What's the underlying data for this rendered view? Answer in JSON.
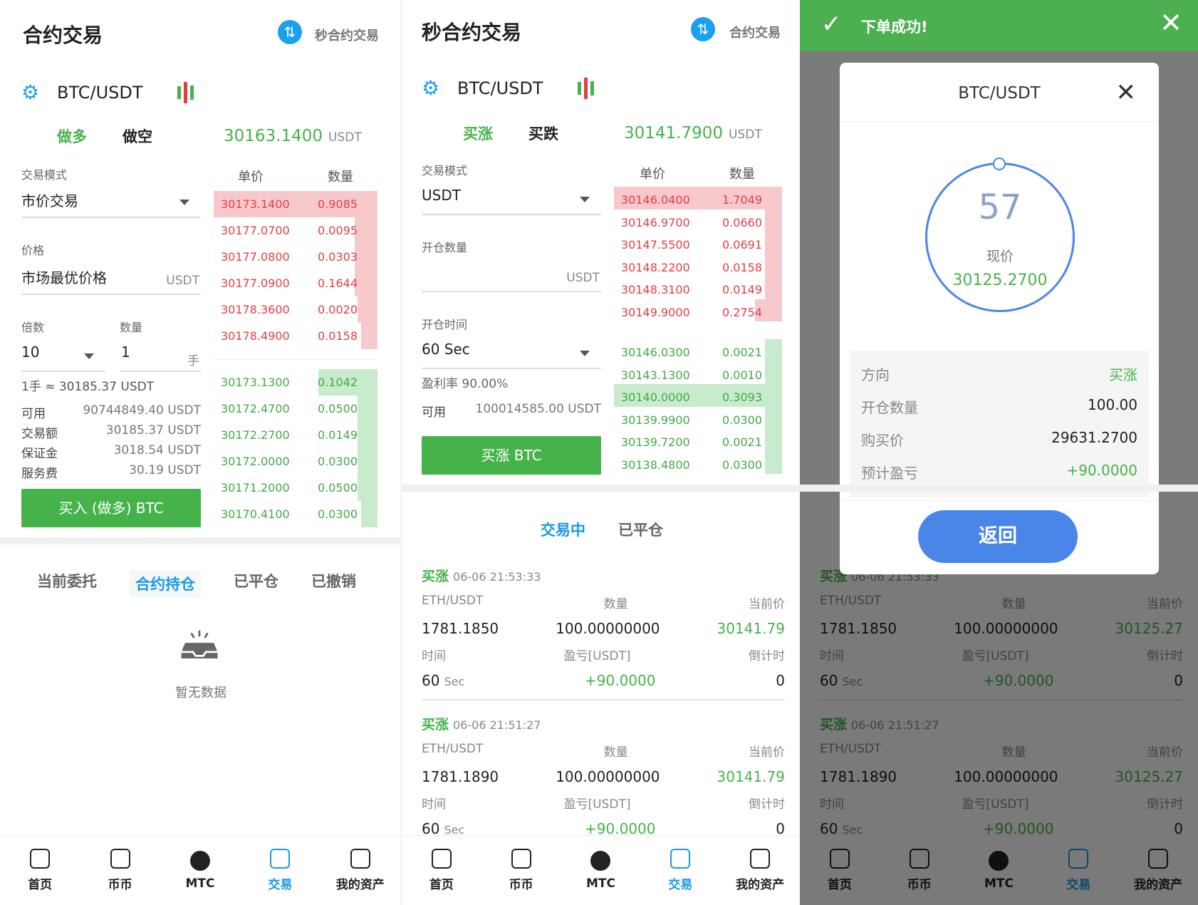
{
  "nav": {
    "home": "首页",
    "coin": "币币",
    "mtc": "MTC",
    "trade": "交易",
    "assets": "我的资产"
  },
  "p1": {
    "title": "合约交易",
    "link": "秒合约交易",
    "pair": "BTC/USDT",
    "tab_long": "做多",
    "tab_short": "做空",
    "price": "30163.1400",
    "unit": "USDT",
    "mode_label": "交易模式",
    "mode_value": "市价交易",
    "price_label": "价格",
    "price_value": "市场最优价格",
    "price_unit": "USDT",
    "mult_label": "倍数",
    "qty_label": "数量",
    "mult_value": "10",
    "qty_value": "1",
    "qty_unit": "手",
    "lot_note": "1手 ≈ 30185.37 USDT",
    "rows": [
      {
        "k": "可用",
        "v": "90744849.40 USDT"
      },
      {
        "k": "交易额",
        "v": "30185.37 USDT"
      },
      {
        "k": "保证金",
        "v": "3018.54 USDT"
      },
      {
        "k": "服务费",
        "v": "30.19 USDT"
      }
    ],
    "buy_btn": "买入 (做多) BTC",
    "ob_price": "单价",
    "ob_qty": "数量",
    "sells": [
      {
        "p": "30173.1400",
        "q": "0.9085",
        "w": 1.0
      },
      {
        "p": "30177.0700",
        "q": "0.0095",
        "w": 0.14
      },
      {
        "p": "30177.0800",
        "q": "0.0303",
        "w": 0.14
      },
      {
        "p": "30177.0900",
        "q": "0.1644",
        "w": 0.14
      },
      {
        "p": "30178.3600",
        "q": "0.0020",
        "w": 0.12
      },
      {
        "p": "30178.4900",
        "q": "0.0158",
        "w": 0.1
      }
    ],
    "buys": [
      {
        "p": "30173.1300",
        "q": "0.1042",
        "w": 0.36
      },
      {
        "p": "30172.4700",
        "q": "0.0500",
        "w": 0.12
      },
      {
        "p": "30172.2700",
        "q": "0.0149",
        "w": 0.12
      },
      {
        "p": "30172.0000",
        "q": "0.0300",
        "w": 0.12
      },
      {
        "p": "30171.2000",
        "q": "0.0500",
        "w": 0.12
      },
      {
        "p": "30170.4100",
        "q": "0.0300",
        "w": 0.1
      }
    ],
    "tabs": [
      "当前委托",
      "合约持仓",
      "已平仓",
      "已撤销"
    ],
    "empty": "暂无数据"
  },
  "p2": {
    "title": "秒合约交易",
    "link": "合约交易",
    "pair": "BTC/USDT",
    "tab_up": "买涨",
    "tab_down": "买跌",
    "price": "30141.7900",
    "unit": "USDT",
    "mode_label": "交易模式",
    "mode_value": "USDT",
    "open_qty_label": "开仓数量",
    "open_qty_unit": "USDT",
    "open_time_label": "开仓时间",
    "open_time_value": "60 Sec",
    "rate": "盈利率 90.00%",
    "avail_k": "可用",
    "avail_v": "100014585.00  USDT",
    "buy_btn": "买涨 BTC",
    "ob_price": "单价",
    "ob_qty": "数量",
    "sells": [
      {
        "p": "30146.0400",
        "q": "1.7049",
        "w": 1.0
      },
      {
        "p": "30146.9700",
        "q": "0.0660",
        "w": 0.1
      },
      {
        "p": "30147.5500",
        "q": "0.0691",
        "w": 0.1
      },
      {
        "p": "30148.2200",
        "q": "0.0158",
        "w": 0.1
      },
      {
        "p": "30148.3100",
        "q": "0.0149",
        "w": 0.1
      },
      {
        "p": "30149.9000",
        "q": "0.2754",
        "w": 0.16
      }
    ],
    "buys": [
      {
        "p": "30146.0300",
        "q": "0.0021",
        "w": 0.1
      },
      {
        "p": "30143.1300",
        "q": "0.0010",
        "w": 0.1
      },
      {
        "p": "30140.0000",
        "q": "0.3093",
        "w": 1.0
      },
      {
        "p": "30139.9900",
        "q": "0.0300",
        "w": 0.1
      },
      {
        "p": "30139.7200",
        "q": "0.0021",
        "w": 0.1
      },
      {
        "p": "30138.4800",
        "q": "0.0300",
        "w": 0.1
      }
    ],
    "tabs": [
      "交易中",
      "已平仓"
    ],
    "orders": [
      {
        "dir": "买涨",
        "time": "06-06 21:53:33",
        "pair": "ETH/USDT",
        "qty_h": "数量",
        "cur_h": "当前价",
        "open": "1781.1850",
        "qty": "100.00000000",
        "cur": "30141.79",
        "t_h": "时间",
        "pl_h": "盈亏[USDT]",
        "cd_h": "倒计时",
        "t": "60",
        "t_unit": "Sec",
        "pl": "+90.0000",
        "cd": "0"
      },
      {
        "dir": "买涨",
        "time": "06-06 21:51:27",
        "pair": "ETH/USDT",
        "qty_h": "数量",
        "cur_h": "当前价",
        "open": "1781.1890",
        "qty": "100.00000000",
        "cur": "30141.79",
        "t_h": "时间",
        "pl_h": "盈亏[USDT]",
        "cd_h": "倒计时",
        "t": "60",
        "t_unit": "Sec",
        "pl": "+90.0000",
        "cd": "0"
      }
    ]
  },
  "p3": {
    "toast": "下单成功!",
    "modal_title": "BTC/USDT",
    "countdown": "57",
    "now_label": "现价",
    "now_price": "30125.2700",
    "info": [
      {
        "k": "方向",
        "v": "买涨",
        "green": true
      },
      {
        "k": "开仓数量",
        "v": "100.00",
        "green": false
      },
      {
        "k": "购买价",
        "v": "29631.2700",
        "green": false
      },
      {
        "k": "预计盈亏",
        "v": "+90.0000",
        "green": true
      }
    ],
    "back": "返回",
    "orders": [
      {
        "dir": "买涨",
        "time": "06-06 21:53:33",
        "pair": "ETH/USDT",
        "qty_h": "数量",
        "cur_h": "当前价",
        "open": "1781.1850",
        "qty": "100.00000000",
        "cur": "30125.27",
        "t_h": "时间",
        "pl_h": "盈亏[USDT]",
        "cd_h": "倒计时",
        "t": "60",
        "t_unit": "Sec",
        "pl": "+90.0000",
        "cd": "0"
      },
      {
        "dir": "买涨",
        "time": "06-06 21:51:27",
        "pair": "ETH/USDT",
        "qty_h": "数量",
        "cur_h": "当前价",
        "open": "1781.1890",
        "qty": "100.00000000",
        "cur": "30125.27",
        "t_h": "时间",
        "pl_h": "盈亏[USDT]",
        "cd_h": "倒计时",
        "t": "60",
        "t_unit": "Sec",
        "pl": "+90.0000",
        "cd": "0"
      }
    ]
  },
  "colors": {
    "green": "#46b34a",
    "red": "#e53d44",
    "blue": "#1a98e8",
    "modal_blue": "#4a86e8",
    "toast": "#4caf50"
  }
}
